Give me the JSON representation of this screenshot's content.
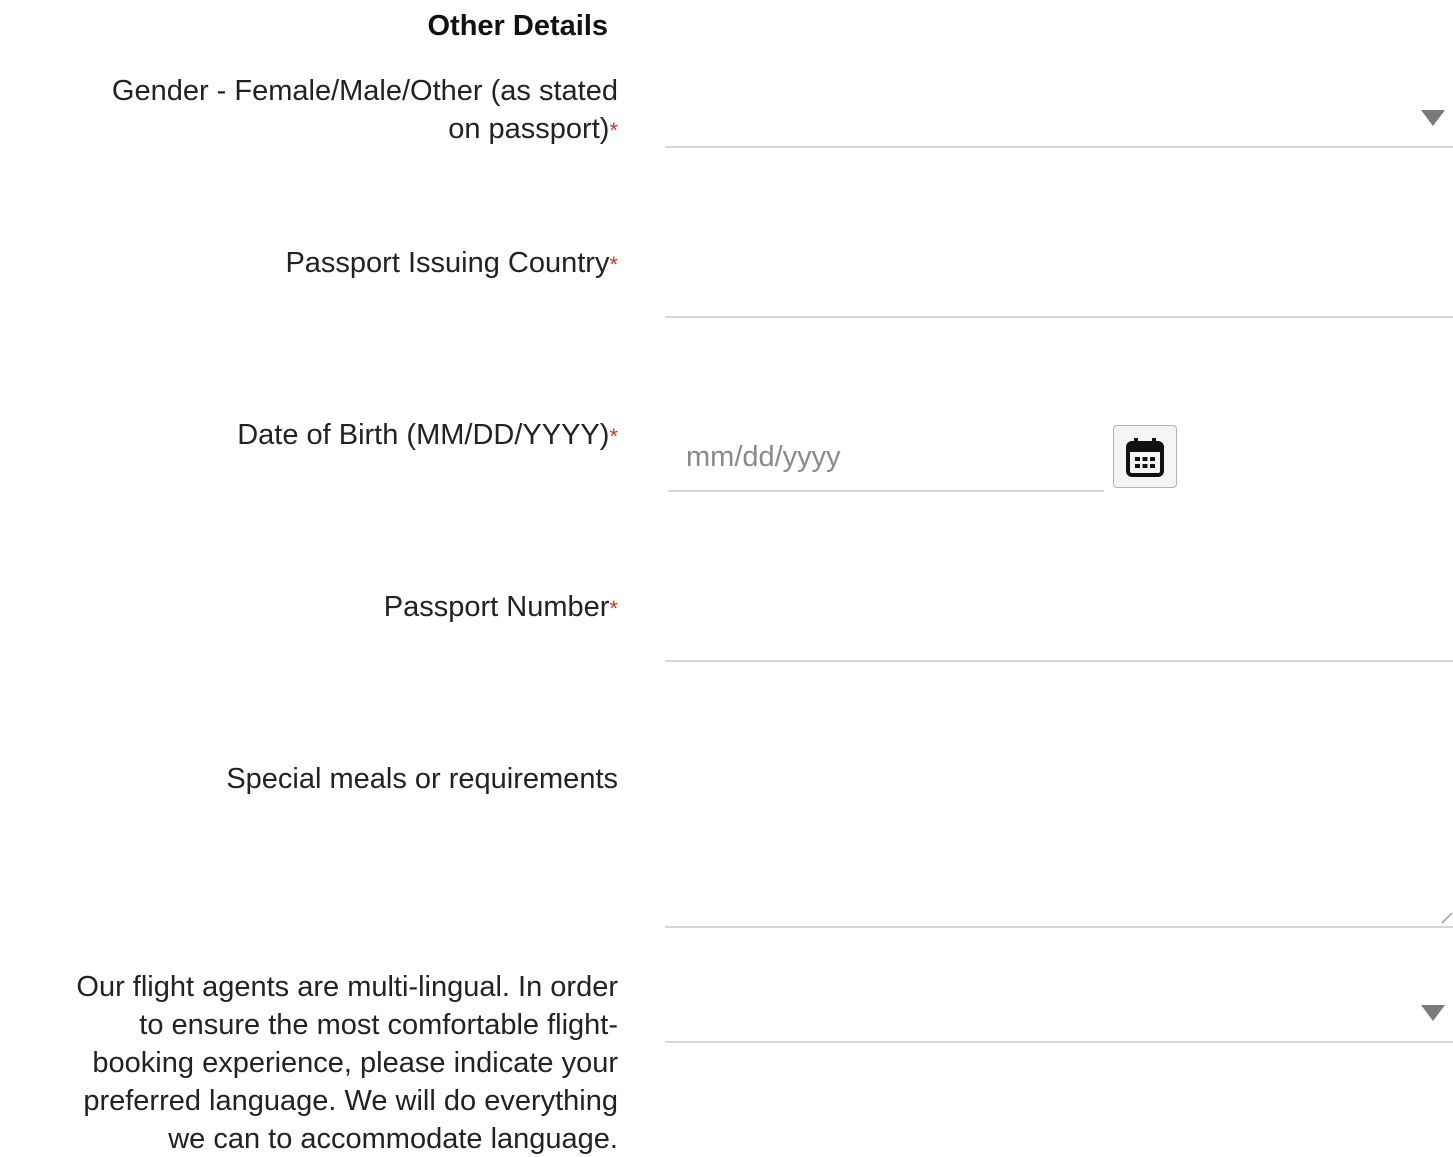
{
  "section": {
    "title": "Other Details"
  },
  "required_marker": "*",
  "fields": {
    "gender": {
      "label_line1": "Gender - Female/Male/Other (as stated",
      "label_line2": "on passport)",
      "value": ""
    },
    "passport_country": {
      "label": "Passport Issuing Country",
      "value": ""
    },
    "dob": {
      "label": "Date of Birth (MM/DD/YYYY)",
      "placeholder": "mm/dd/yyyy"
    },
    "passport_number": {
      "label": "Passport Number",
      "value": ""
    },
    "special_meals": {
      "label": "Special meals or requirements",
      "value": ""
    },
    "language": {
      "label_lines": [
        "Our flight agents are multi-lingual. In order",
        "to ensure the most comfortable flight-",
        "booking experience, please indicate your",
        "preferred language. We will do everything",
        "we can to accommodate language."
      ],
      "value": ""
    }
  },
  "icons": {
    "dropdown": "chevron-down-icon",
    "calendar": "calendar-icon"
  },
  "colors": {
    "required": "#c0392b",
    "underline": "#d6d6d6",
    "placeholder": "#8a8a8a",
    "arrow": "#7a7a7a"
  }
}
